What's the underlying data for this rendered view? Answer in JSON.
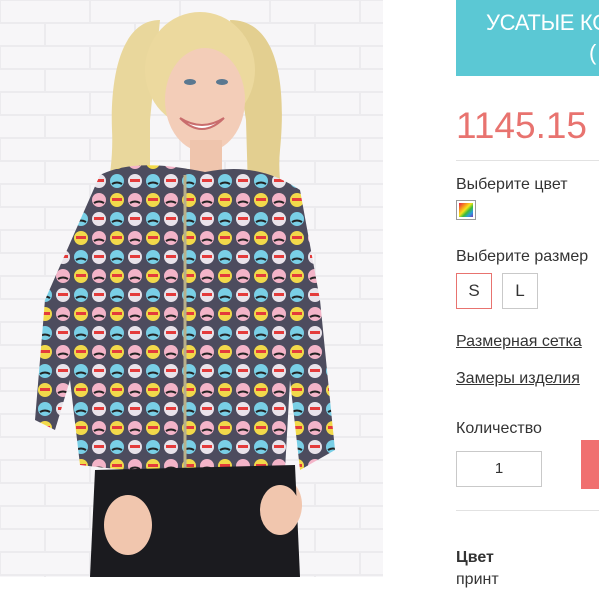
{
  "product": {
    "title_line1": "УСАТЫЕ КО",
    "title_line2": "(",
    "price": "1145.15"
  },
  "color": {
    "label": "Выберите цвет",
    "swatch_icon": "rainbow-swatch-icon"
  },
  "size": {
    "label": "Выберите размер",
    "options": [
      "S",
      "L"
    ],
    "selected": "S"
  },
  "links": {
    "size_chart": "Размерная сетка",
    "measurements": "Замеры изделия"
  },
  "quantity": {
    "label": "Количество",
    "value": "1"
  },
  "add_button": {
    "label": "",
    "color": "#f07070"
  },
  "attributes": [
    {
      "name": "Цвет",
      "value": "принт"
    }
  ],
  "colors": {
    "banner": "#5bc8d4",
    "price": "#e8736f",
    "selected_border": "#e8736f"
  }
}
